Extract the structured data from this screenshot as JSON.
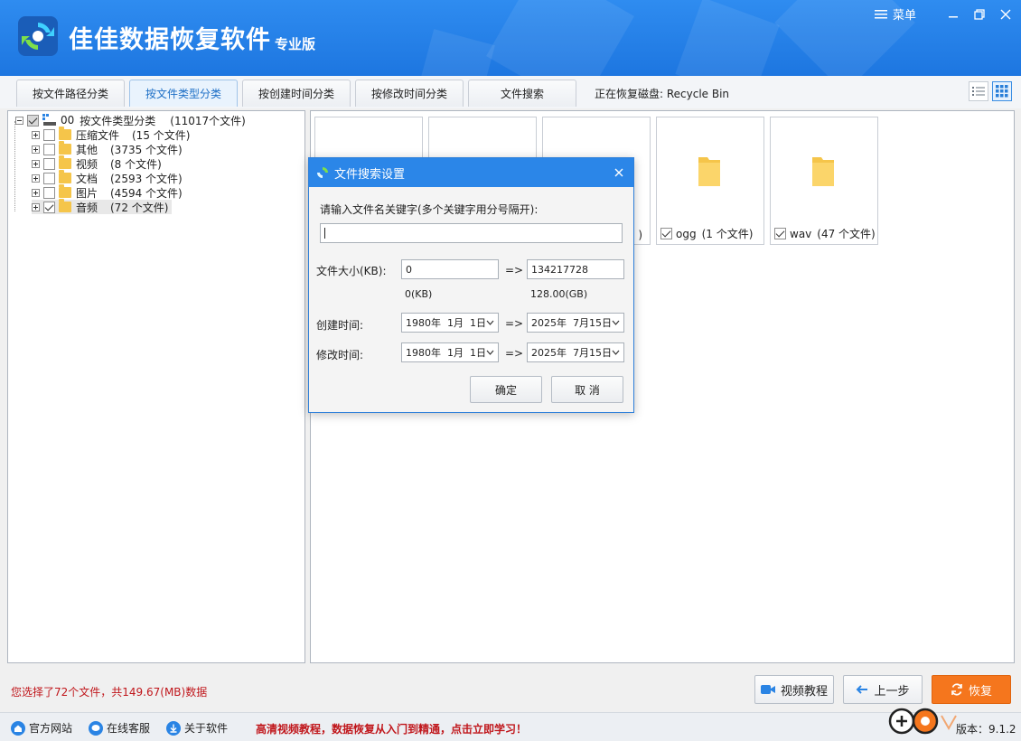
{
  "app": {
    "title": "佳佳数据恢复软件",
    "edition": "专业版",
    "menu_label": "菜单"
  },
  "tabs": [
    {
      "label": "按文件路径分类",
      "active": false
    },
    {
      "label": "按文件类型分类",
      "active": true
    },
    {
      "label": "按创建时间分类",
      "active": false
    },
    {
      "label": "按修改时间分类",
      "active": false
    },
    {
      "label": "文件搜索",
      "active": false
    }
  ],
  "disk_label": "正在恢复磁盘: Recycle Bin",
  "tree": {
    "root": {
      "code": "00",
      "label": "按文件类型分类",
      "count": "(11017个文件)"
    },
    "items": [
      {
        "label": "压缩文件",
        "count": "(15 个文件)",
        "checked": false
      },
      {
        "label": "其他",
        "count": "(3735 个文件)",
        "checked": false
      },
      {
        "label": "视频",
        "count": "(8 个文件)",
        "checked": false
      },
      {
        "label": "文档",
        "count": "(2593 个文件)",
        "checked": false
      },
      {
        "label": "图片",
        "count": "(4594 个文件)",
        "checked": false
      },
      {
        "label": "音频",
        "count": "(72 个文件)",
        "checked": true
      }
    ]
  },
  "files": [
    {
      "name": "",
      "count": "",
      "checked": true
    },
    {
      "name": "",
      "count": "",
      "checked": true
    },
    {
      "name": "",
      "count": ")",
      "checked": true
    },
    {
      "name": "ogg",
      "count": "(1 个文件)",
      "checked": true
    },
    {
      "name": "wav",
      "count": "(47 个文件)",
      "checked": true
    }
  ],
  "dialog": {
    "title": "文件搜索设置",
    "keyword_label": "请输入文件名关键字(多个关键字用分号隔开):",
    "keyword_value": "",
    "size_label": "文件大小(KB):",
    "size_min": "0",
    "size_max": "134217728",
    "size_min_hint": "0(KB)",
    "size_max_hint": "128.00(GB)",
    "arrow": "=>",
    "created_label": "创建时间:",
    "created_from": "1980年  1月  1日",
    "created_to": "2025年  7月15日",
    "modified_label": "修改时间:",
    "modified_from": "1980年  1月  1日",
    "modified_to": "2025年  7月15日",
    "ok_label": "确定",
    "cancel_label": "取 消"
  },
  "status": "您选择了72个文件，共149.67(MB)数据",
  "buttons": {
    "tutorial": "视频教程",
    "back": "上一步",
    "recover": "恢复"
  },
  "footer": {
    "website": "官方网站",
    "support": "在线客服",
    "about": "关于软件",
    "promo": "高清视频教程，数据恢复从入门到精通，点击立即学习！",
    "version": "版本：9.1.2"
  },
  "colors": {
    "header_blue": "#1d76e0",
    "accent_orange": "#f5761d",
    "status_red": "#c0161b",
    "folder_yellow": "#f5c54a"
  }
}
